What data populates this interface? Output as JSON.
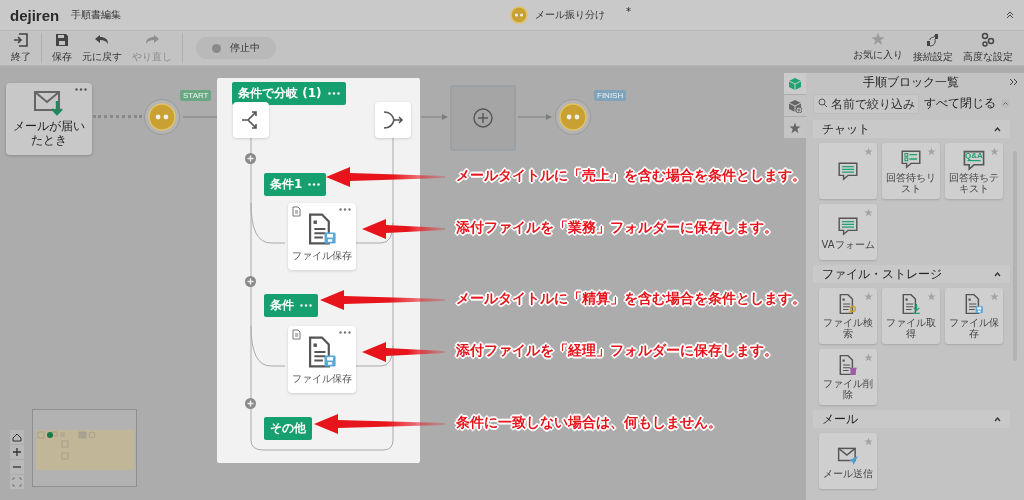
{
  "header": {
    "logo": "dejiren",
    "page_title": "手順書編集",
    "flow_name": "メール振り分け",
    "unsaved_mark": "*"
  },
  "toolbar": {
    "left": [
      {
        "label": "終了",
        "kind": "exit",
        "disabled": false
      },
      {
        "label": "保存",
        "kind": "save",
        "disabled": false
      },
      {
        "label": "元に戻す",
        "kind": "undo",
        "disabled": false
      },
      {
        "label": "やり直し",
        "kind": "redo",
        "disabled": true
      }
    ],
    "status": {
      "label": "停止中",
      "on": false
    },
    "right": [
      {
        "label": "お気に入り",
        "kind": "star"
      },
      {
        "label": "接続設定",
        "kind": "connect"
      },
      {
        "label": "高度な設定",
        "kind": "gears"
      }
    ]
  },
  "flow": {
    "trigger": {
      "label": "メールが届いたとき"
    },
    "start_label": "START",
    "branch": {
      "title": "条件で分岐 (1)",
      "conditions": [
        {
          "label": "条件1",
          "menu": true,
          "step": {
            "label": "ファイル保存"
          }
        },
        {
          "label": "条件",
          "menu": true,
          "step": {
            "label": "ファイル保存"
          }
        },
        {
          "label": "その他",
          "menu": false
        }
      ]
    },
    "finish_label": "FINISH"
  },
  "annotations": [
    {
      "text": "メールタイトルに「売上」を含む場合を条件とします。"
    },
    {
      "text": "添付ファイルを「業務」フォルダーに保存します。"
    },
    {
      "text": "メールタイトルに「精算」を含む場合を条件とします。"
    },
    {
      "text": "添付ファイルを「経理」フォルダーに保存します。"
    },
    {
      "text": "条件に一致しない場合は、何もしません。"
    }
  ],
  "panel": {
    "title": "手順ブロック一覧",
    "tabs": [
      {
        "kind": "cube",
        "selected": true
      },
      {
        "kind": "cube-plus",
        "selected": false
      },
      {
        "kind": "star",
        "selected": false
      }
    ],
    "search": {
      "placeholder": "名前で絞り込み"
    },
    "collapse_all": "すべて閉じる",
    "sections": [
      {
        "title": "チャット",
        "expanded": true,
        "blocks": [
          {
            "kind": "chat-lines"
          },
          {
            "label": "回答待ちリスト",
            "kind": "chat-list"
          },
          {
            "label": "回答待ちテキスト",
            "kind": "chat-qa",
            "icon_text": "Q&A"
          },
          {
            "label": "VAフォーム",
            "kind": "chat-lines"
          }
        ]
      },
      {
        "title": "ファイル・ストレージ",
        "expanded": true,
        "blocks": [
          {
            "label": "ファイル検索",
            "kind": "file-search"
          },
          {
            "label": "ファイル取得",
            "kind": "file-get"
          },
          {
            "label": "ファイル保存",
            "kind": "file-save"
          },
          {
            "label": "ファイル削除",
            "kind": "file-delete"
          }
        ]
      },
      {
        "title": "メール",
        "expanded": true,
        "blocks": [
          {
            "label": "メール送信",
            "kind": "mail-send"
          }
        ]
      }
    ]
  }
}
